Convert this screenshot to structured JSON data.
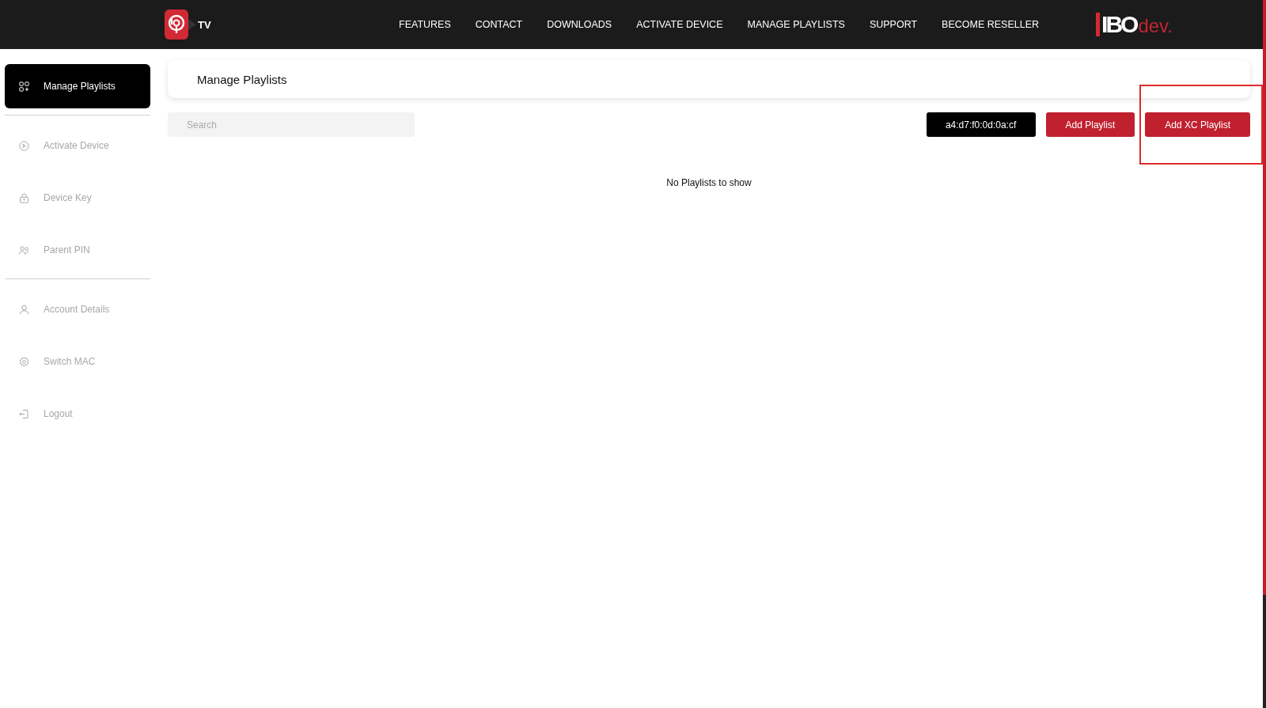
{
  "header": {
    "logo_text": "TV",
    "nav": [
      {
        "label": "FEATURES"
      },
      {
        "label": "CONTACT"
      },
      {
        "label": "DOWNLOADS"
      },
      {
        "label": "ACTIVATE DEVICE"
      },
      {
        "label": "MANAGE PLAYLISTS"
      },
      {
        "label": "SUPPORT"
      },
      {
        "label": "BECOME RESELLER"
      }
    ],
    "brand": {
      "main": "IBO",
      "suffix": "dev."
    }
  },
  "sidebar": {
    "groups": [
      [
        {
          "label": "Manage Playlists",
          "selected": true
        }
      ],
      [
        {
          "label": "Activate Device",
          "selected": false
        },
        {
          "label": "Device Key",
          "selected": false
        },
        {
          "label": "Parent PIN",
          "selected": false
        }
      ],
      [
        {
          "label": "Account Details",
          "selected": false
        },
        {
          "label": "Switch MAC",
          "selected": false
        },
        {
          "label": "Logout",
          "selected": false
        }
      ]
    ]
  },
  "page_title": "Manage Playlists",
  "search": {
    "placeholder": "Search"
  },
  "mac_address": "a4:d7:f0:0d:0a:cf",
  "buttons": [
    {
      "label": "Add Playlist",
      "highlighted": false
    },
    {
      "label": "Add XC Playlist",
      "highlighted": true
    }
  ],
  "empty_message": "No Playlists to show"
}
